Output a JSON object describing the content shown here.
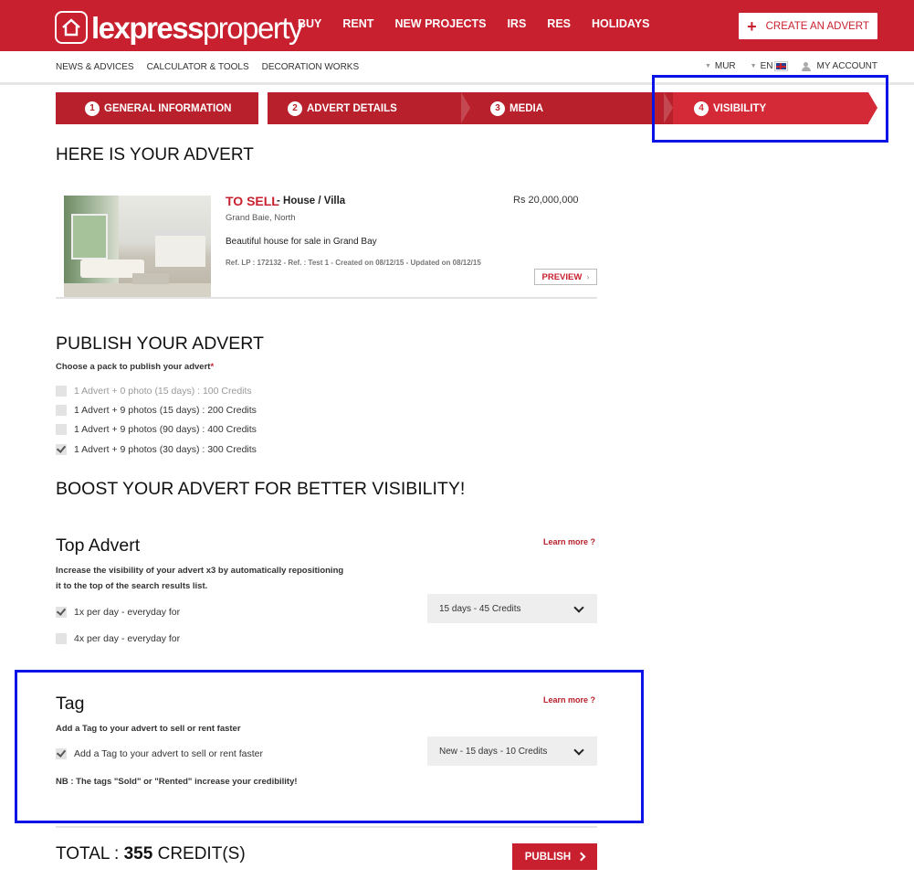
{
  "header": {
    "logo": {
      "bold": "lexpress",
      "light": "property"
    },
    "nav": [
      "BUY",
      "RENT",
      "NEW PROJECTS",
      "IRS",
      "RES",
      "HOLIDAYS"
    ],
    "create_label": "CREATE AN ADVERT",
    "brand_color": "#c8202f"
  },
  "subnav": {
    "links": [
      "NEWS & ADVICES",
      "CALCULATOR & TOOLS",
      "DECORATION WORKS"
    ],
    "currency": "MUR",
    "language": "EN",
    "account": "MY ACCOUNT"
  },
  "steps": [
    {
      "num": "1",
      "label": "GENERAL INFORMATION"
    },
    {
      "num": "2",
      "label": "ADVERT DETAILS"
    },
    {
      "num": "3",
      "label": "MEDIA"
    },
    {
      "num": "4",
      "label": "VISIBILITY",
      "active": true
    }
  ],
  "advert": {
    "section_title": "HERE IS YOUR ADVERT",
    "type": "TO SELL",
    "kind": "- House / Villa",
    "price": "Rs 20,000,000",
    "location": "Grand Baie, North",
    "description": "Beautiful house for sale in Grand Bay",
    "ref": "Ref. LP : 172132 - Ref. : Test 1 - Created on 08/12/15 - Updated on 08/12/15",
    "preview_label": "PREVIEW"
  },
  "publish": {
    "title": "PUBLISH YOUR ADVERT",
    "choose_label": "Choose a pack to publish your advert",
    "required_mark": "*",
    "options": [
      {
        "label": "1 Advert + 0 photo (15 days) : 100 Credits",
        "checked": false,
        "disabled": true
      },
      {
        "label": "1 Advert + 9 photos (15 days) : 200 Credits",
        "checked": false
      },
      {
        "label": "1 Advert + 9 photos (90 days) : 400 Credits",
        "checked": false
      },
      {
        "label": "1 Advert + 9 photos (30 days) : 300 Credits",
        "checked": true
      }
    ]
  },
  "boost": {
    "title": "BOOST YOUR ADVERT FOR BETTER VISIBILITY!"
  },
  "top_advert": {
    "title": "Top Advert",
    "learn_more": "Learn more ?",
    "desc_line1": "Increase the visibility of your advert x3 by automatically repositioning",
    "desc_line2": "it to the top of the search results list.",
    "options": [
      {
        "label": "1x per day - everyday for",
        "checked": true
      },
      {
        "label": "4x per day - everyday for",
        "checked": false
      }
    ],
    "select_value": "15 days - 45 Credits"
  },
  "tag": {
    "title": "Tag",
    "learn_more": "Learn more ?",
    "desc": "Add a Tag to your advert to sell or rent faster",
    "option_label": "Add a Tag to your advert to sell or rent faster",
    "select_value": "New - 15 days - 10 Credits",
    "note": "NB : The tags \"Sold\" or \"Rented\" increase your credibility!"
  },
  "total": {
    "prefix": "TOTAL : ",
    "amount": "355",
    "suffix": " CREDIT(S)",
    "publish_label": "PUBLISH"
  }
}
